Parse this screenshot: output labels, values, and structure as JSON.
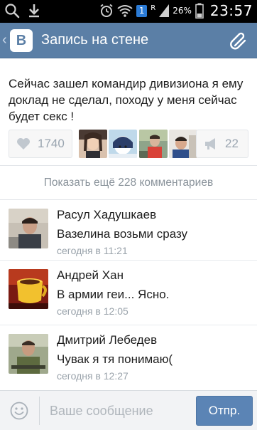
{
  "status_bar": {
    "signal_badge": "1",
    "network_letter": "R",
    "battery_percent": "26%",
    "time": "23:57"
  },
  "header": {
    "title": "Запись на стене",
    "logo_text": "В"
  },
  "post": {
    "text": "Сейчас зашел командир дивизиона я ему доклад не сделал, походу у меня сейчас будет секс !",
    "likes": "1740",
    "reposts": "22"
  },
  "show_more": "Показать ещё 228 комментариев",
  "comments": [
    {
      "author": "Расул Хадушкаев",
      "text": "Вазелина возьми сразу",
      "time": "сегодня в 11:21"
    },
    {
      "author": "Андрей Хан",
      "text": "В армии геи... Ясно.",
      "time": "сегодня в 12:05"
    },
    {
      "author": "Дмитрий Лебедев",
      "text": "Чувак я тя понимаю(",
      "time": "сегодня в 12:27"
    }
  ],
  "composer": {
    "placeholder": "Ваше сообщение",
    "send_label": "Отпр."
  },
  "colors": {
    "header_bg": "#5b7fa6",
    "send_button": "#5b84b5",
    "secondary_text": "#9aa3ab"
  }
}
